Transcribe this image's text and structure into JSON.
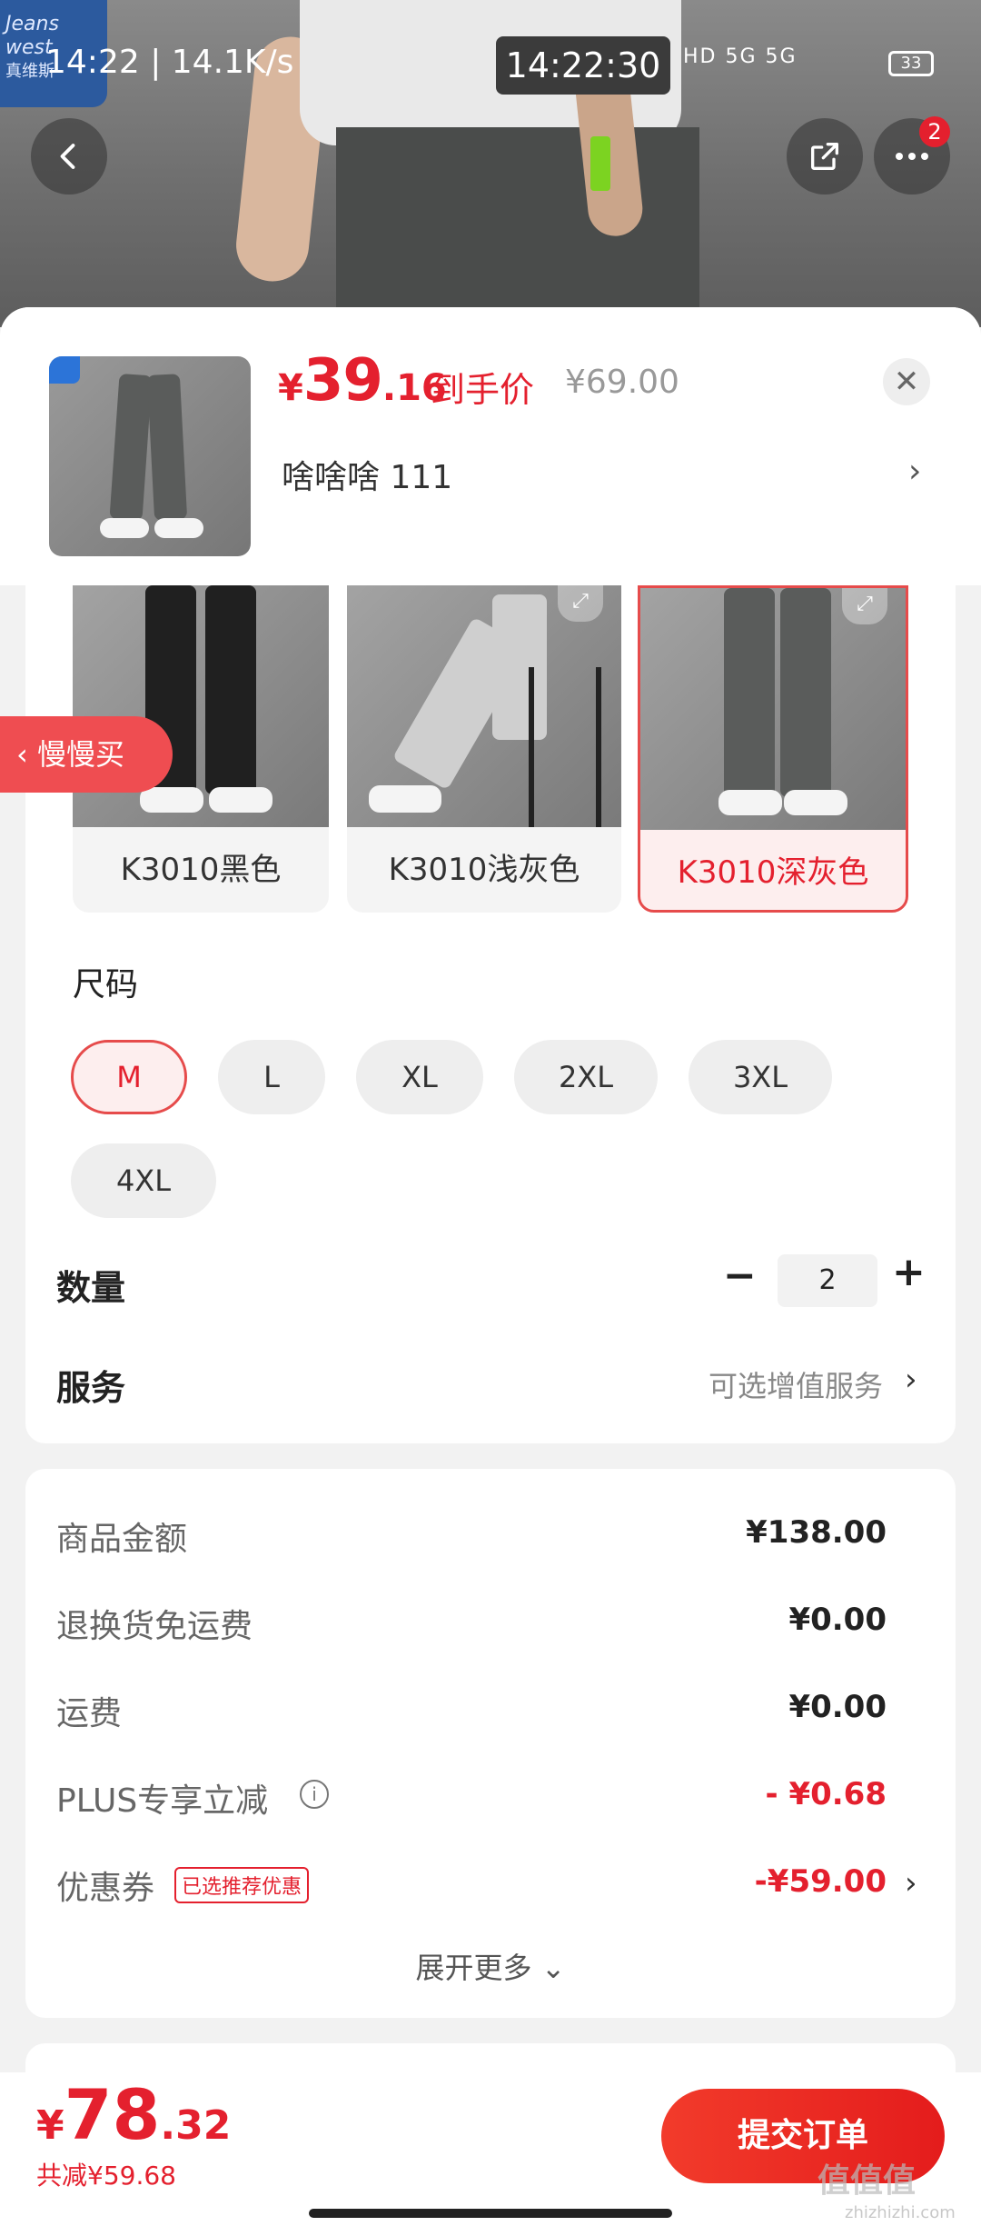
{
  "status_bar": {
    "time_left": "14:22 | 14.1K/s",
    "time_center": "14:22:30",
    "network": "HD 5G 5G",
    "battery": "33"
  },
  "brand_logo": {
    "text_top": "Jeans",
    "text_mid": "west",
    "text_cn": "真维斯"
  },
  "nav": {
    "more_badge": "2"
  },
  "product": {
    "price_currency": "¥",
    "price_int": "39",
    "price_dec": ".16",
    "price_label": "到手价",
    "original_price": "¥69.00",
    "name": "啥啥啥  111"
  },
  "colors": [
    {
      "label": "K3010黑色",
      "selected": false
    },
    {
      "label": "K3010浅灰色",
      "selected": false
    },
    {
      "label": "K3010深灰色",
      "selected": true
    }
  ],
  "slow_buy_label": "慢慢买",
  "size_section": {
    "title": "尺码",
    "options": [
      "M",
      "L",
      "XL",
      "2XL",
      "3XL",
      "4XL"
    ],
    "selected": "M"
  },
  "quantity": {
    "title": "数量",
    "value": "2"
  },
  "service": {
    "title": "服务",
    "value": "可选增值服务"
  },
  "breakdown": {
    "rows": [
      {
        "label": "商品金额",
        "value": "¥138.00",
        "red": false
      },
      {
        "label": "退换货免运费",
        "value": "¥0.00",
        "red": false
      },
      {
        "label": "运费",
        "value": "¥0.00",
        "red": false
      },
      {
        "label": "PLUS专享立减",
        "value": "- ¥0.68",
        "red": true
      },
      {
        "label": "优惠券",
        "value": "-¥59.00",
        "red": true
      }
    ],
    "coupon_tag": "已选推荐优惠",
    "expand_more": "展开更多"
  },
  "footer": {
    "total_currency": "¥",
    "total_int": "78",
    "total_dec": ".32",
    "saved": "共减¥59.68",
    "submit_label": "提交订单"
  },
  "watermark": {
    "main": "值值值",
    "sub": "zhizhizhi.com"
  },
  "colors_palette": {
    "accent_red": "#e4202e",
    "selected_border": "#e64b4b",
    "selected_bg": "#fdeeee"
  }
}
